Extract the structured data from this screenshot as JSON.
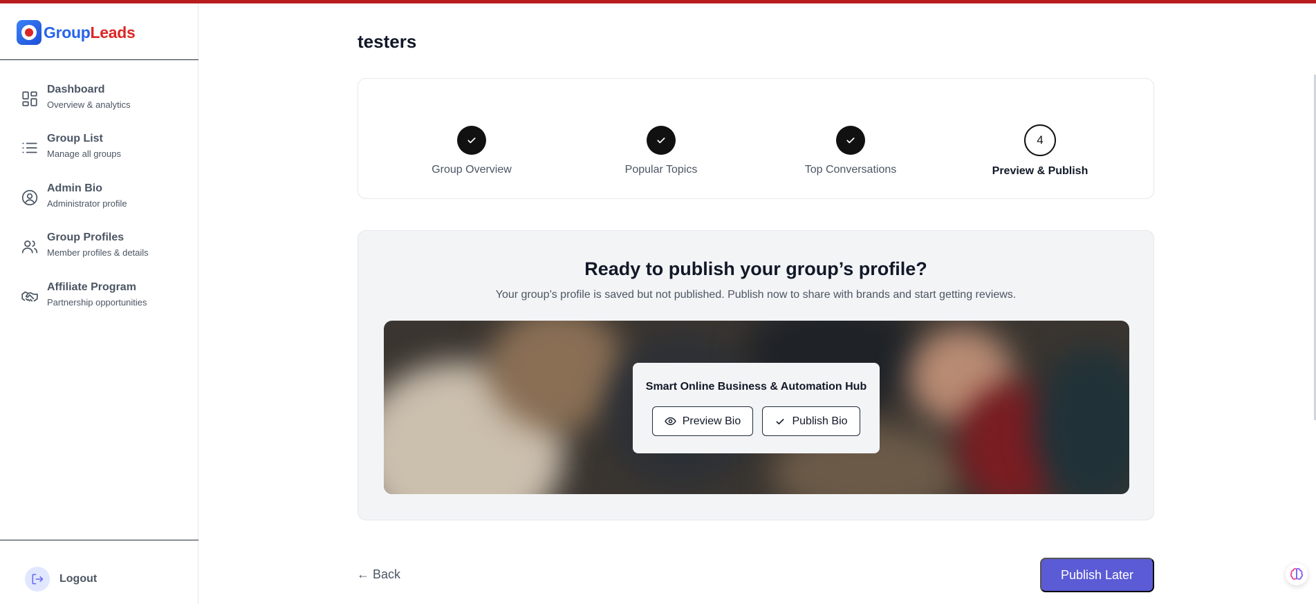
{
  "brand": {
    "part1": "Group",
    "part2": "Leads"
  },
  "sidebar": {
    "items": [
      {
        "title": "Dashboard",
        "subtitle": "Overview & analytics",
        "icon": "grid-icon"
      },
      {
        "title": "Group List",
        "subtitle": "Manage all groups",
        "icon": "list-icon"
      },
      {
        "title": "Admin Bio",
        "subtitle": "Administrator profile",
        "icon": "user-circle-icon"
      },
      {
        "title": "Group Profiles",
        "subtitle": "Member profiles & details",
        "icon": "users-icon"
      },
      {
        "title": "Affiliate Program",
        "subtitle": "Partnership opportunities",
        "icon": "handshake-icon"
      }
    ],
    "logout": "Logout"
  },
  "page": {
    "title": "testers"
  },
  "stepper": {
    "steps": [
      {
        "label": "Group Overview",
        "status": "complete"
      },
      {
        "label": "Popular Topics",
        "status": "complete"
      },
      {
        "label": "Top Conversations",
        "status": "complete"
      },
      {
        "label": "Preview & Publish",
        "number": "4",
        "status": "active"
      }
    ]
  },
  "publish": {
    "title": "Ready to publish your group’s profile?",
    "subtitle": "Your group’s profile is saved but not published. Publish now to share with brands and start getting reviews.",
    "group_name": "Smart Online Business & Automation Hub",
    "preview_label": "Preview Bio",
    "publish_label": "Publish Bio"
  },
  "footer": {
    "back_label": "← Back",
    "publish_later_label": "Publish Later"
  },
  "colors": {
    "accent": "#5b5bd6",
    "topbar": "#b91c1c",
    "brand_blue": "#2563eb",
    "brand_red": "#dc2626"
  }
}
